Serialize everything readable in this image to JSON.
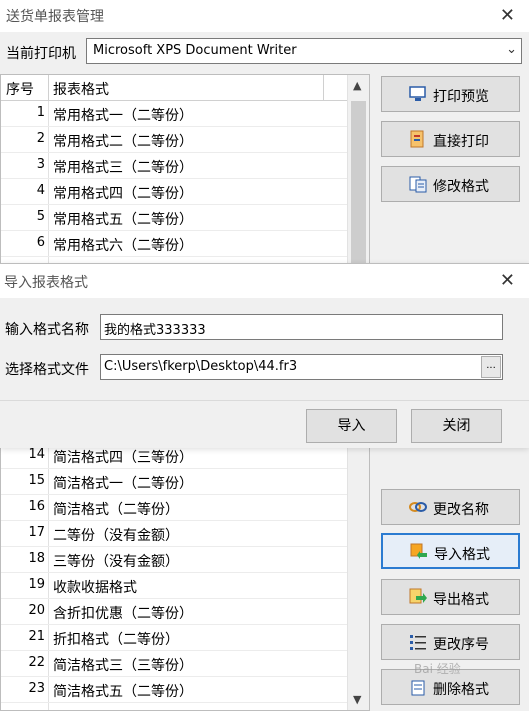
{
  "main": {
    "title": "送货单报表管理",
    "close_glyph": "✕",
    "printer_label": "当前打印机",
    "printer_value": "Microsoft XPS Document Writer",
    "list_header": {
      "num": "序号",
      "format": "报表格式"
    },
    "rows_top": [
      {
        "num": "1",
        "label": "常用格式一（二等份）"
      },
      {
        "num": "2",
        "label": "常用格式二（二等份）"
      },
      {
        "num": "3",
        "label": "常用格式三（二等份）"
      },
      {
        "num": "4",
        "label": "常用格式四（二等份）"
      },
      {
        "num": "5",
        "label": "常用格式五（二等份）"
      },
      {
        "num": "6",
        "label": "常用格式六（二等份）"
      }
    ],
    "rows_bottom": [
      {
        "num": "14",
        "label": "简洁格式四（三等份）"
      },
      {
        "num": "15",
        "label": "简洁格式一（二等份）"
      },
      {
        "num": "16",
        "label": "简洁格式（二等份）"
      },
      {
        "num": "17",
        "label": "二等份（没有金额）"
      },
      {
        "num": "18",
        "label": "三等份（没有金额）"
      },
      {
        "num": "19",
        "label": "收款收据格式"
      },
      {
        "num": "20",
        "label": "含折扣优惠（二等份）"
      },
      {
        "num": "21",
        "label": "折扣格式（二等份）"
      },
      {
        "num": "22",
        "label": "简洁格式三（三等份）"
      },
      {
        "num": "23",
        "label": "简洁格式五（二等份）"
      }
    ],
    "buttons": {
      "print_preview": "打印预览",
      "print_direct": "直接打印",
      "edit_format": "修改格式",
      "rename": "更改名称",
      "import_format": "导入格式",
      "export_format": "导出格式",
      "change_order": "更改序号",
      "delete_format": "删除格式"
    }
  },
  "dialog": {
    "title": "导入报表格式",
    "close_glyph": "✕",
    "name_label": "输入格式名称",
    "name_value": "我的格式333333",
    "file_label": "选择格式文件",
    "file_value": "C:\\Users\\fkerp\\Desktop\\44.fr3",
    "browse_label": "...",
    "import_button": "导入",
    "close_button": "关闭"
  },
  "watermark": "Bai 经验",
  "colors": {
    "accent": "#2b7bd1",
    "window_bg": "#f0f0f0"
  }
}
